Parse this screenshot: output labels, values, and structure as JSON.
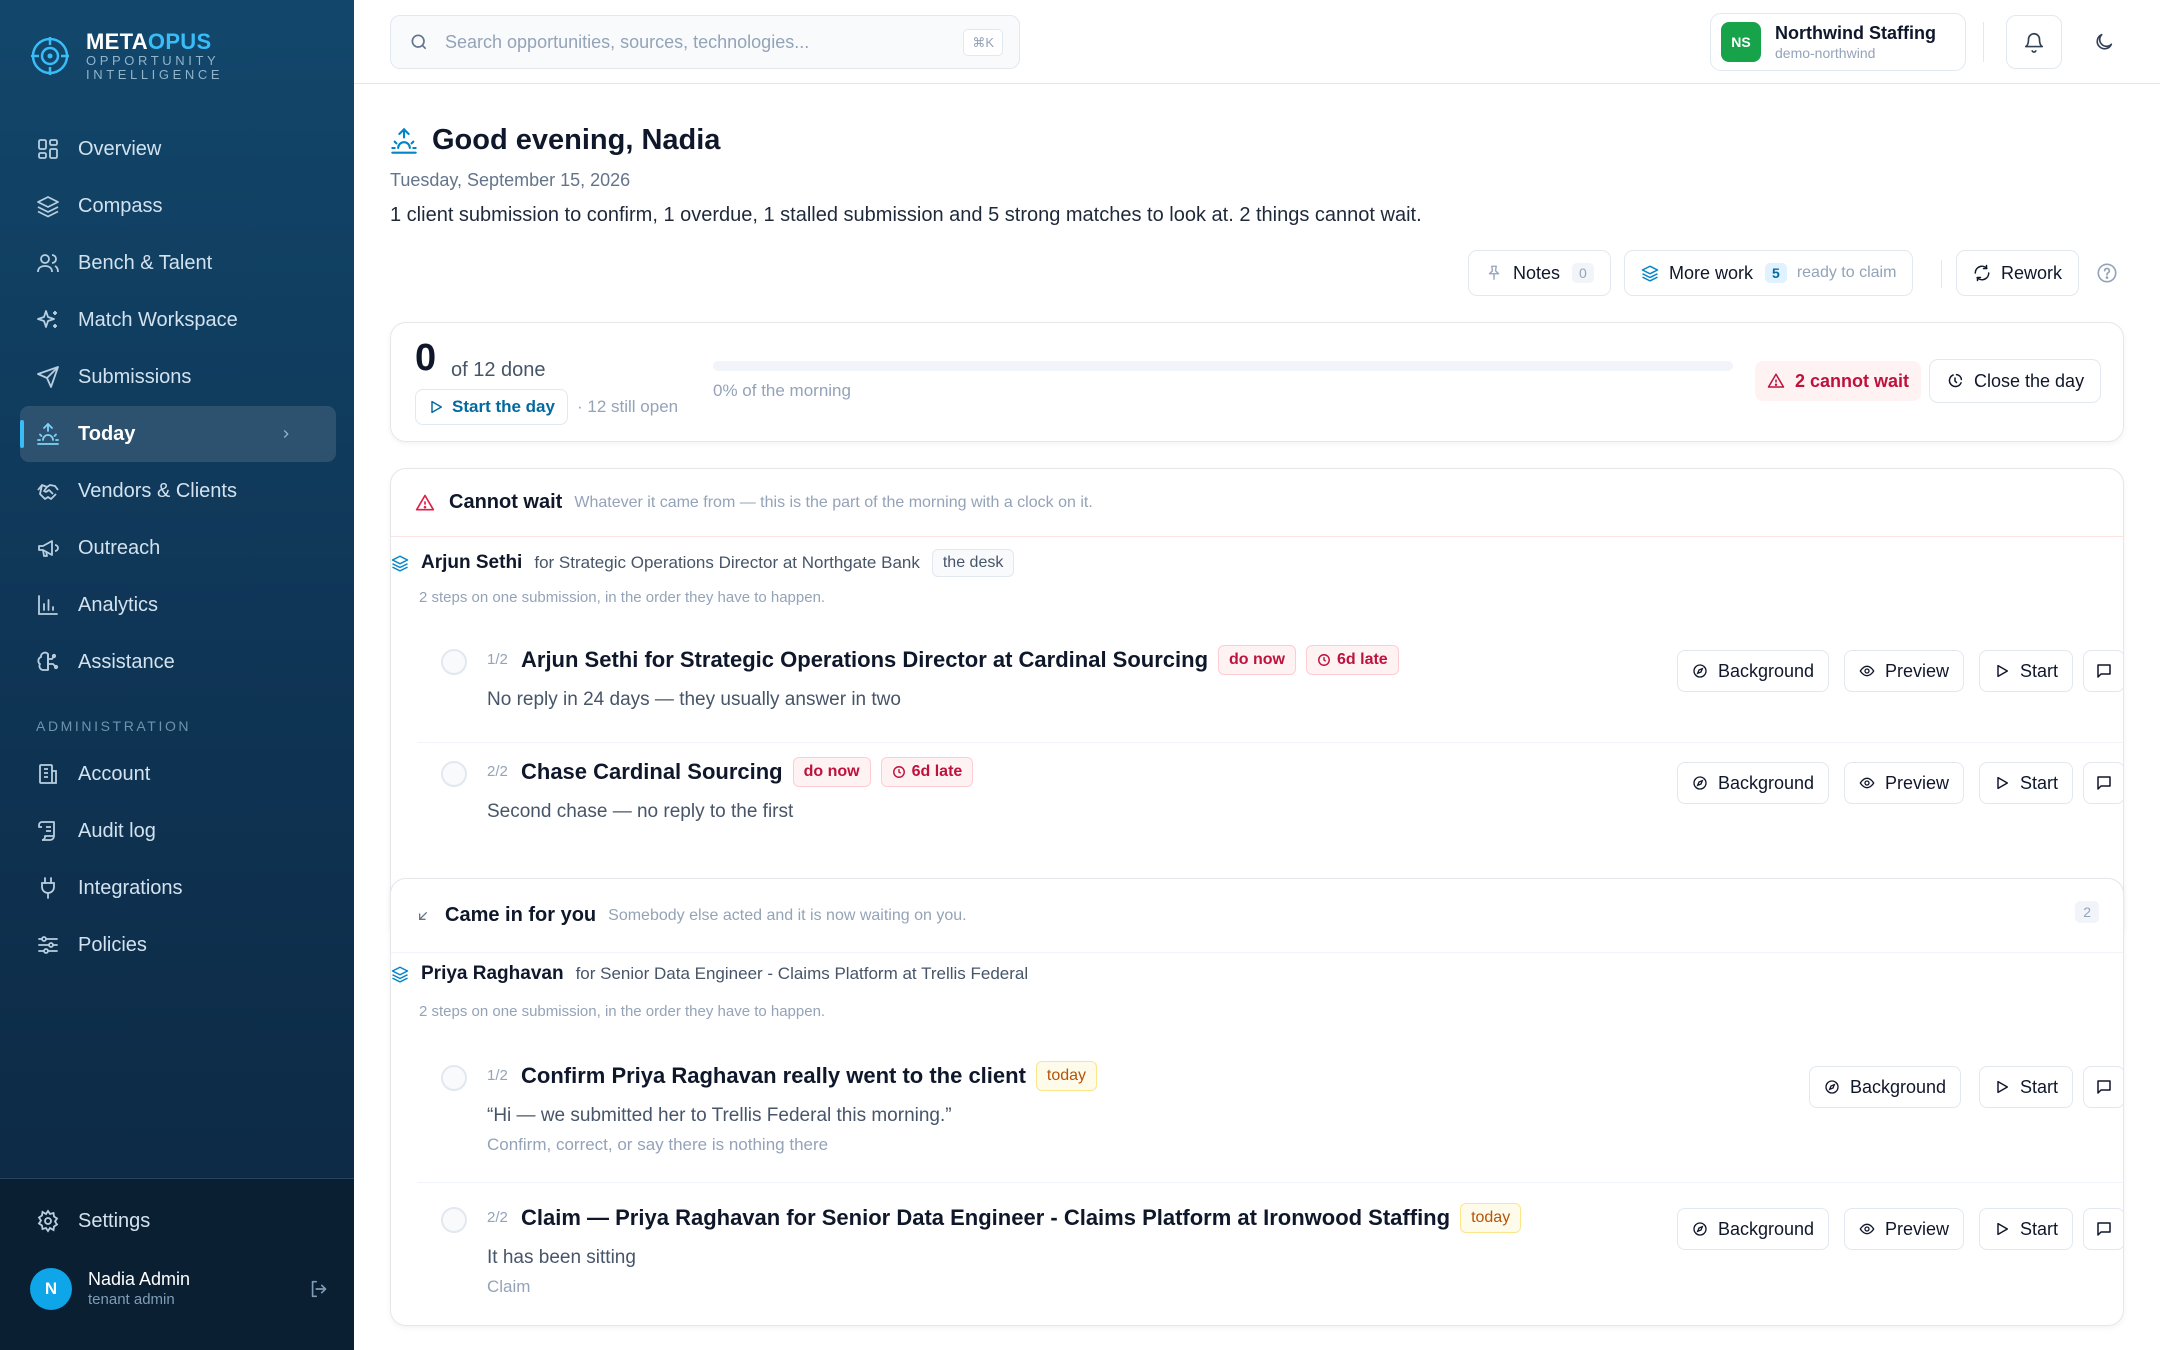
{
  "brand": {
    "name_a": "META",
    "name_b": "OPUS",
    "tagline": "OPPORTUNITY INTELLIGENCE"
  },
  "nav": {
    "items": [
      {
        "label": "Overview",
        "icon": "grid-icon"
      },
      {
        "label": "Compass",
        "icon": "layers-icon"
      },
      {
        "label": "Bench & Talent",
        "icon": "users-icon"
      },
      {
        "label": "Match Workspace",
        "icon": "sparkles-icon"
      },
      {
        "label": "Submissions",
        "icon": "send-icon"
      },
      {
        "label": "Today",
        "icon": "sunrise-icon",
        "active": true
      },
      {
        "label": "Vendors & Clients",
        "icon": "handshake-icon"
      },
      {
        "label": "Outreach",
        "icon": "megaphone-icon"
      },
      {
        "label": "Analytics",
        "icon": "bar-chart-icon"
      },
      {
        "label": "Assistance",
        "icon": "brain-icon"
      }
    ],
    "admin_label": "ADMINISTRATION",
    "admin_items": [
      {
        "label": "Account",
        "icon": "building-icon"
      },
      {
        "label": "Audit log",
        "icon": "scroll-icon"
      },
      {
        "label": "Integrations",
        "icon": "plug-icon"
      },
      {
        "label": "Policies",
        "icon": "sliders-icon"
      }
    ],
    "settings": "Settings"
  },
  "user": {
    "initial": "N",
    "name": "Nadia Admin",
    "role": "tenant admin"
  },
  "topbar": {
    "search_placeholder": "Search opportunities, sources, technologies...",
    "shortcut": "⌘K",
    "tenant_initials": "NS",
    "tenant_name": "Northwind Staffing",
    "tenant_slug": "demo-northwind"
  },
  "page": {
    "greeting": "Good evening, Nadia",
    "date": "Tuesday, September 15, 2026",
    "summary": "1 client submission to confirm, 1 overdue, 1 stalled submission and 5 strong matches to look at. 2 things cannot wait."
  },
  "toolbar": {
    "notes": "Notes",
    "notes_count": "0",
    "more_work": "More work",
    "more_count": "5",
    "more_hint": "ready to claim",
    "rework": "Rework"
  },
  "progress": {
    "done": "0",
    "of_total": "of 12 done",
    "start_day": "Start the day",
    "still_open": "· 12 still open",
    "percent": 0,
    "bar_label": "0% of the morning",
    "cannot_wait": "2 cannot wait",
    "close_day": "Close the day"
  },
  "cannot_wait": {
    "title": "Cannot wait",
    "subtitle": "Whatever it came from — this is the part of the morning with a clock on it.",
    "group": {
      "name": "Arjun Sethi",
      "for": "for Strategic Operations Director at Northgate Bank",
      "tag": "the desk",
      "note": "2 steps on one submission, in the order they have to happen."
    },
    "tasks": [
      {
        "step": "1/2",
        "title": "Arjun Sethi for Strategic Operations Director at Cardinal Sourcing",
        "pill1": "do now",
        "pill2": "6d late",
        "desc": "No reply in 24 days — they usually answer in two"
      },
      {
        "step": "2/2",
        "title": "Chase Cardinal Sourcing",
        "pill1": "do now",
        "pill2": "6d late",
        "desc": "Second chase — no reply to the first"
      }
    ]
  },
  "came_in": {
    "title": "Came in for you",
    "subtitle": "Somebody else acted and it is now waiting on you.",
    "count": "2",
    "group": {
      "name": "Priya Raghavan",
      "for": "for Senior Data Engineer - Claims Platform at Trellis Federal",
      "note": "2 steps on one submission, in the order they have to happen."
    },
    "tasks": [
      {
        "step": "1/2",
        "title": "Confirm Priya Raghavan really went to the client",
        "pill": "today",
        "desc": "“Hi — we submitted her to Trellis Federal this morning.”",
        "sub": "Confirm, correct, or say there is nothing there"
      },
      {
        "step": "2/2",
        "title": "Claim — Priya Raghavan for Senior Data Engineer - Claims Platform at Ironwood Staffing",
        "pill": "today",
        "desc": "It has been sitting",
        "sub": "Claim"
      }
    ]
  },
  "actions": {
    "background": "Background",
    "preview": "Preview",
    "start": "Start"
  },
  "colors": {
    "accent": "#0ea5e9",
    "danger": "#be123c",
    "sidebar": "#0f3657",
    "tenant": "#16a34a"
  }
}
